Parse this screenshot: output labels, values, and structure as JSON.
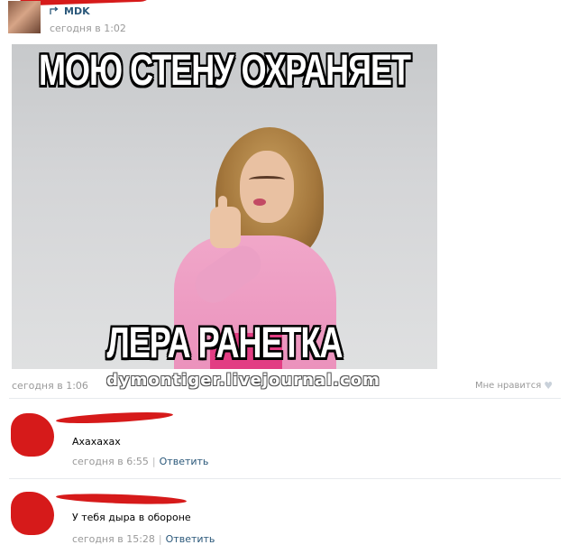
{
  "post": {
    "author": "MDK",
    "time": "сегодня в 1:02",
    "image_time": "сегодня в 1:06",
    "like_label": "Мне нравится",
    "watermark": "dymontiger.livejournal.com"
  },
  "meme": {
    "top_text": "МОЮ СТЕНУ ОХРАНЯЕТ",
    "bottom_text": "ЛЕРА РАНЕТКА"
  },
  "comments": [
    {
      "text": "Ахахахах",
      "time": "сегодня в 6:55",
      "reply_label": "Ответить",
      "separator": "|"
    },
    {
      "text": "У тебя дыра в обороне",
      "time": "сегодня в 15:28",
      "reply_label": "Ответить",
      "separator": "|"
    }
  ],
  "colors": {
    "link": "#2b587a",
    "meta": "#999999",
    "scribble": "#d61a1a"
  },
  "icons": {
    "repost": "repost-icon",
    "like": "heart-icon"
  }
}
